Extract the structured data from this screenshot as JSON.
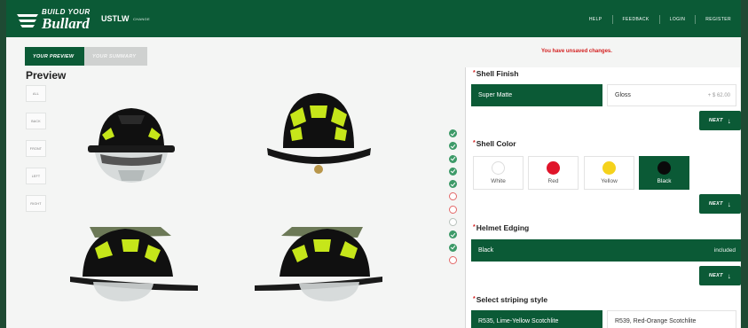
{
  "header": {
    "logo_line1": "BUILD YOUR",
    "logo_line2": "Bullard",
    "model": "USTLW",
    "change_label": "CHANGE",
    "nav": [
      "HELP",
      "FEEDBACK",
      "LOGIN",
      "REGISTER"
    ]
  },
  "tabs": {
    "active": "YOUR PREVIEW",
    "inactive": "YOUR SUMMARY"
  },
  "preview_title": "Preview",
  "views": [
    "ALL",
    "BACK",
    "FRONT",
    "LEFT",
    "RIGHT"
  ],
  "unsaved_message": "You have unsaved changes.",
  "progress": [
    "done",
    "done",
    "done",
    "done",
    "done",
    "error",
    "error",
    "empty",
    "done",
    "done",
    "error"
  ],
  "shell_finish": {
    "title": "Shell Finish",
    "options": [
      {
        "label": "Super Matte",
        "price": "",
        "selected": true
      },
      {
        "label": "Gloss",
        "price": "+ $ 62.00",
        "selected": false
      }
    ]
  },
  "shell_color": {
    "title": "Shell Color",
    "options": [
      {
        "label": "White",
        "color": "#ffffff",
        "selected": false
      },
      {
        "label": "Red",
        "color": "#e0142a",
        "selected": false
      },
      {
        "label": "Yellow",
        "color": "#f5d21c",
        "selected": false
      },
      {
        "label": "Black",
        "color": "#0a0a0a",
        "selected": true
      }
    ]
  },
  "helmet_edging": {
    "title": "Helmet Edging",
    "value": "Black",
    "note": "included"
  },
  "striping": {
    "title": "Select striping style",
    "options": [
      {
        "label": "R535, Lime-Yellow Scotchlite",
        "selected": true
      },
      {
        "label": "R539, Red-Orange Scotchlite",
        "selected": false
      }
    ]
  },
  "next_label": "NEXT",
  "colors": {
    "brand": "#0b5a36",
    "error": "#d32020",
    "accent_reflective": "#c6e61a"
  }
}
